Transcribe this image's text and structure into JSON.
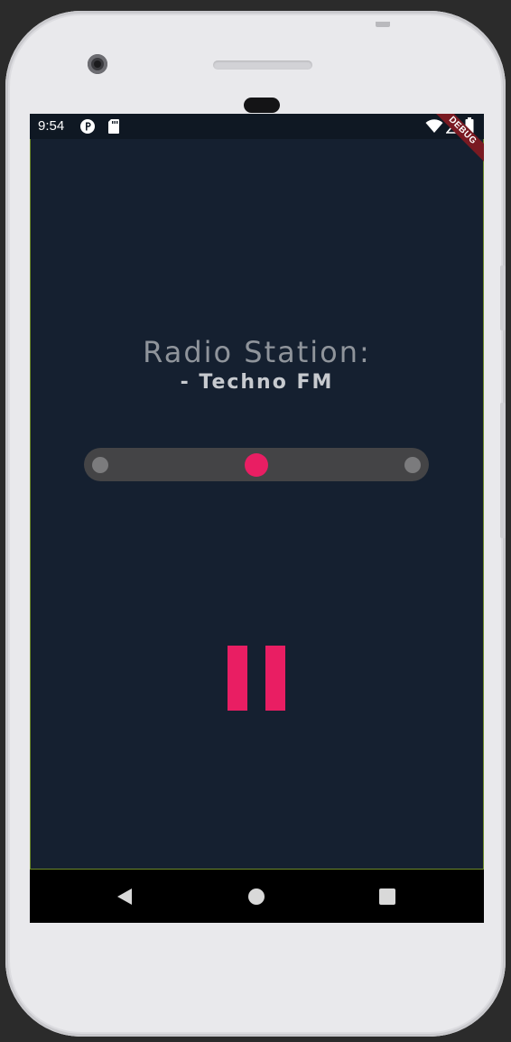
{
  "status_bar": {
    "time": "9:54",
    "icons": [
      "notification-p-icon",
      "sd-card-icon",
      "wifi-icon",
      "signal-icon",
      "battery-icon"
    ]
  },
  "debug_banner": {
    "label": "DEBUG",
    "color": "#7a1a22"
  },
  "station": {
    "title": "Radio Station:",
    "name": "- Techno FM"
  },
  "slider": {
    "value": 0.5,
    "track_color": "#444446",
    "thumb_color": "#e91e63"
  },
  "player": {
    "state": "playing",
    "control_icon": "pause-icon",
    "accent_color": "#e91e63"
  },
  "navigation": {
    "buttons": [
      "back-icon",
      "home-icon",
      "recents-icon"
    ]
  },
  "theme": {
    "background": "#152030",
    "title_color": "#8f949b",
    "subtitle_color": "#c7cacf"
  }
}
